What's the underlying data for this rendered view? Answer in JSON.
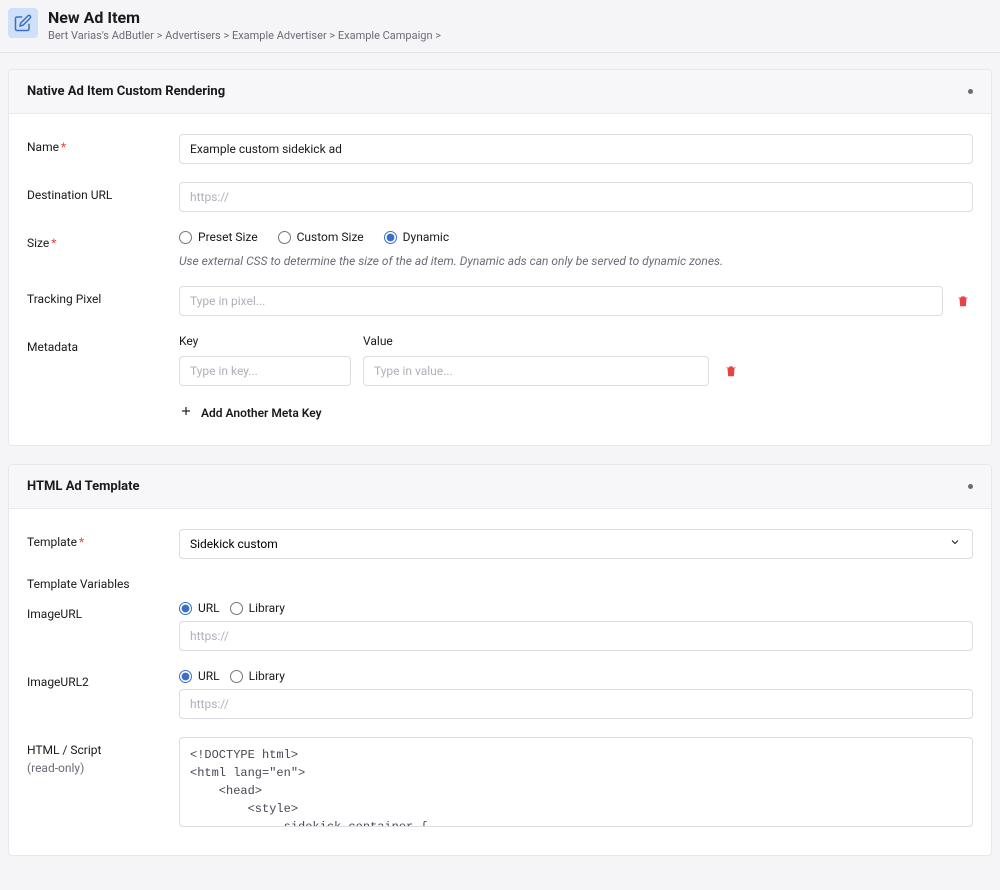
{
  "header": {
    "title": "New Ad Item",
    "breadcrumbs": [
      "Bert Varias's AdButler",
      "Advertisers",
      "Example Advertiser",
      "Example Campaign"
    ]
  },
  "section1": {
    "title": "Native Ad Item Custom Rendering",
    "fields": {
      "name_label": "Name",
      "name_value": "Example custom sidekick ad",
      "dest_label": "Destination URL",
      "dest_placeholder": "https://",
      "size_label": "Size",
      "size_opt1": "Preset Size",
      "size_opt2": "Custom Size",
      "size_opt3": "Dynamic",
      "size_helper": "Use external CSS to determine the size of the ad item. Dynamic ads can only be served to dynamic zones.",
      "pixel_label": "Tracking Pixel",
      "pixel_placeholder": "Type in pixel...",
      "meta_label": "Metadata",
      "meta_key_label": "Key",
      "meta_val_label": "Value",
      "meta_key_placeholder": "Type in key...",
      "meta_val_placeholder": "Type in value...",
      "add_meta": "Add Another Meta Key"
    }
  },
  "section2": {
    "title": "HTML Ad Template",
    "template_label": "Template",
    "template_value": "Sidekick custom",
    "vars_label": "Template Variables",
    "imgurl_label": "ImageURL",
    "imgurl2_label": "ImageURL2",
    "opt_url": "URL",
    "opt_library": "Library",
    "https_placeholder": "https://",
    "html_label": "HTML / Script",
    "readonly_note": "(read-only)",
    "code": "<!DOCTYPE html>\n<html lang=\"en\">\n    <head>\n        <style>\n            .sidekick-container {\n                position: relative;\n                width: fit-content;\n            }"
  }
}
